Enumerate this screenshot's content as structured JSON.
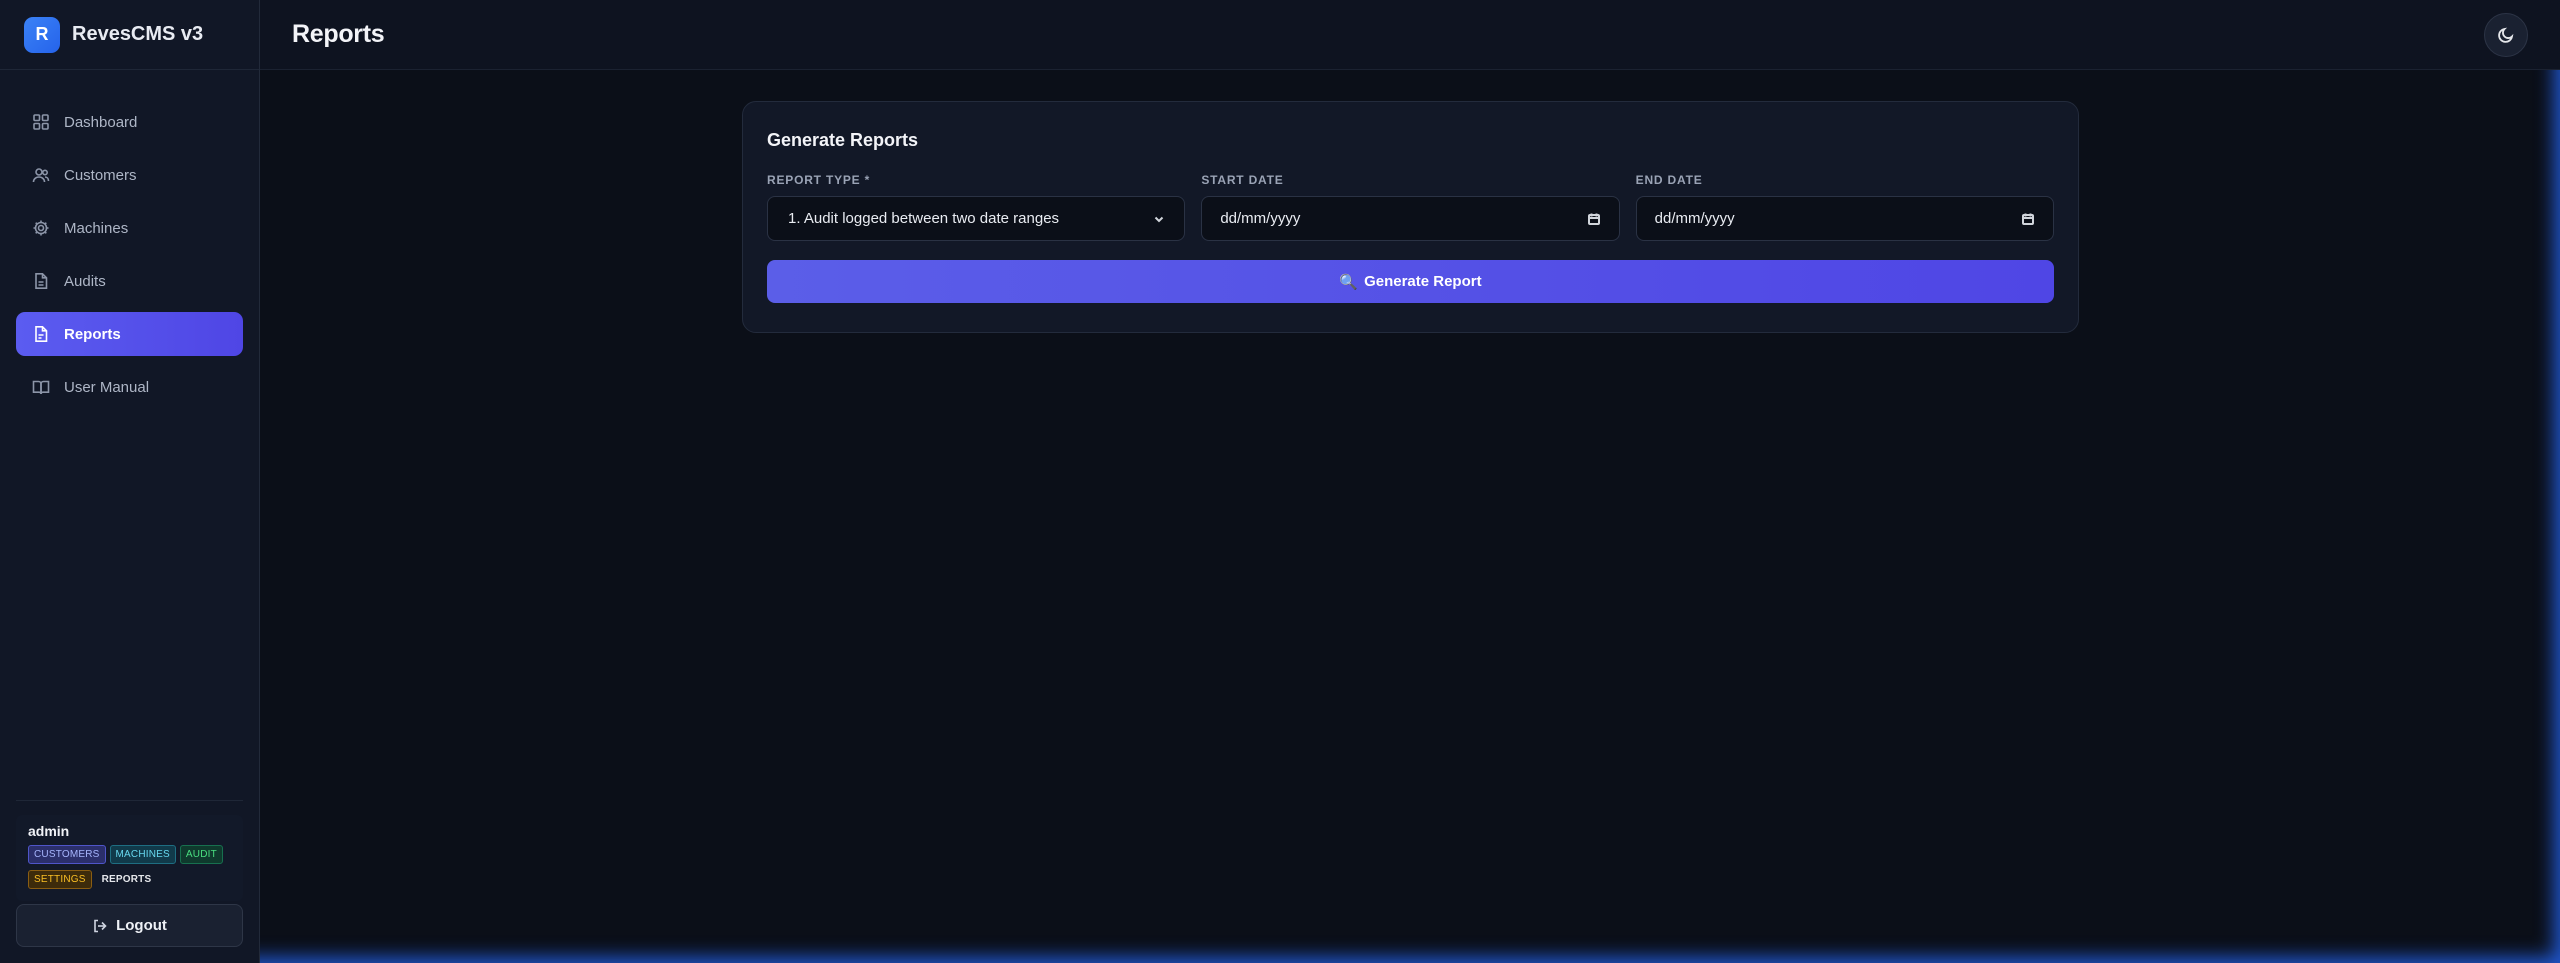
{
  "app": {
    "logo_letter": "R",
    "name": "RevesCMS v3"
  },
  "sidebar": {
    "items": [
      {
        "label": "Dashboard",
        "icon": "grid-icon",
        "active": false
      },
      {
        "label": "Customers",
        "icon": "users-icon",
        "active": false
      },
      {
        "label": "Machines",
        "icon": "gear-icon",
        "active": false
      },
      {
        "label": "Audits",
        "icon": "file-icon",
        "active": false
      },
      {
        "label": "Reports",
        "icon": "report-icon",
        "active": true
      },
      {
        "label": "User Manual",
        "icon": "book-icon",
        "active": false
      }
    ]
  },
  "user": {
    "name": "admin",
    "permissions": [
      "CUSTOMERS",
      "MACHINES",
      "AUDIT",
      "SETTINGS",
      "REPORTS"
    ]
  },
  "logout_label": "Logout",
  "header": {
    "title": "Reports",
    "theme_icon": "moon-icon"
  },
  "card": {
    "title": "Generate Reports",
    "report_type": {
      "label": "REPORT TYPE *",
      "value": "1. Audit logged between two date ranges"
    },
    "start_date": {
      "label": "START DATE",
      "placeholder": "dd/mm/yyyy"
    },
    "end_date": {
      "label": "END DATE",
      "placeholder": "dd/mm/yyyy"
    },
    "button": {
      "icon": "🔍",
      "label": "Generate Report"
    }
  },
  "colors": {
    "accent": "#4f46e5",
    "background": "#0b0f18",
    "sidebar": "#111726",
    "frame_glow": "#2563eb"
  }
}
